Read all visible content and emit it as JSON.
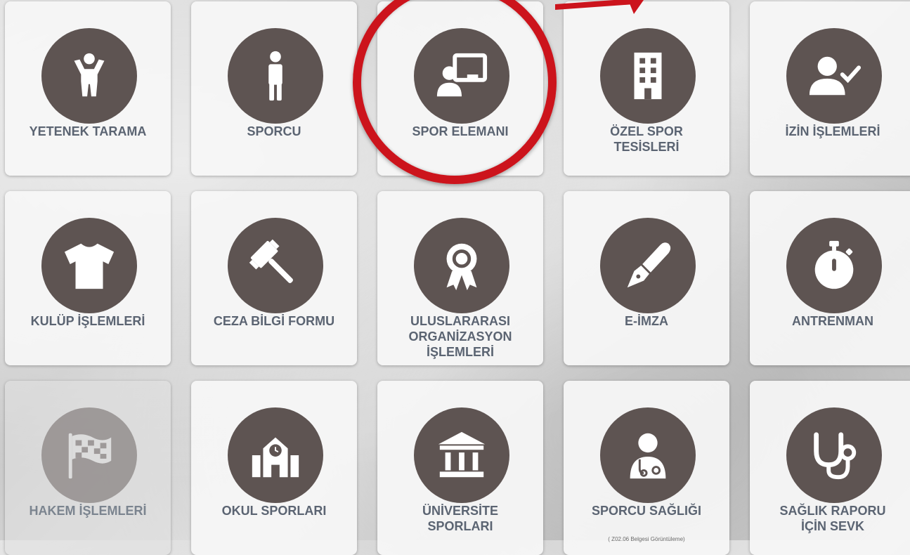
{
  "tiles": [
    {
      "label": "YETENEK TARAMA",
      "icon": "child-icon"
    },
    {
      "label": "SPORCU",
      "icon": "person-icon"
    },
    {
      "label": "SPOR ELEMANI",
      "icon": "presentation-board-icon"
    },
    {
      "label": "ÖZEL SPOR\nTESİSLERİ",
      "icon": "building-icon"
    },
    {
      "label": "İZİN İŞLEMLERİ",
      "icon": "user-check-icon"
    },
    {
      "label": "KULÜP İŞLEMLERİ",
      "icon": "tshirt-icon"
    },
    {
      "label": "CEZA BİLGİ FORMU",
      "icon": "gavel-icon"
    },
    {
      "label": "ULUSLARARASI\nORGANİZASYON\nİŞLEMLERİ",
      "icon": "award-ribbon-icon"
    },
    {
      "label": "E-İMZA",
      "icon": "fountain-pen-icon"
    },
    {
      "label": "ANTRENMAN",
      "icon": "stopwatch-icon"
    },
    {
      "label": "HAKEM İŞLEMLERİ",
      "icon": "checkered-flag-icon"
    },
    {
      "label": "OKUL SPORLARI",
      "icon": "school-icon"
    },
    {
      "label": "ÜNİVERSİTE\nSPORLARI",
      "icon": "university-icon"
    },
    {
      "label": "SPORCU SAĞLIĞI",
      "sub": "( Z02.06 Belgesi Görüntüleme)",
      "icon": "doctor-icon"
    },
    {
      "label": "SAĞLIK RAPORU\nİÇİN SEVK",
      "icon": "stethoscope-icon"
    }
  ],
  "colors": {
    "icon_circle": "#5e5452",
    "label": "#5b6472",
    "highlight": "#cc141c"
  }
}
